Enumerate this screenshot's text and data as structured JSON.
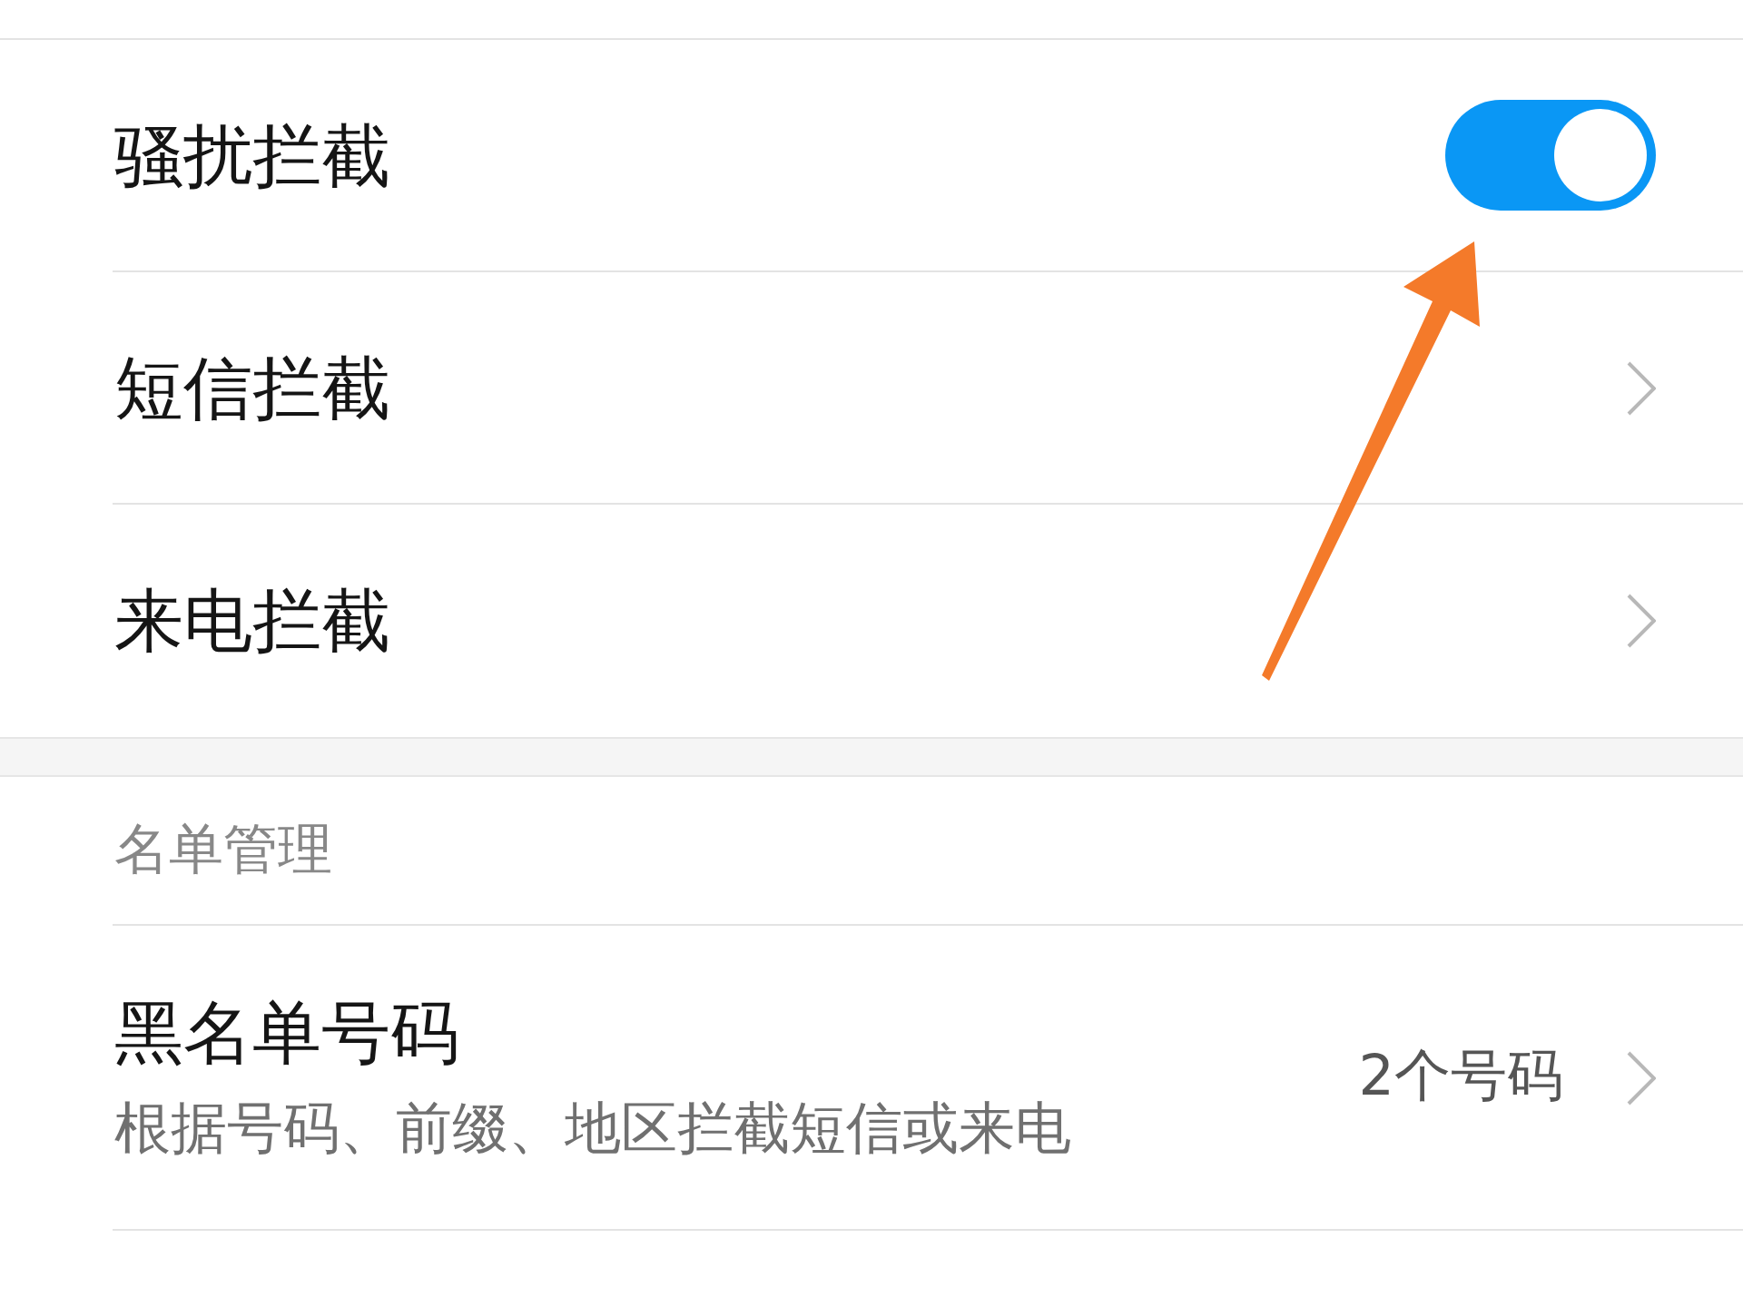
{
  "sections": [
    {
      "items": [
        {
          "kind": "toggle",
          "label": "骚扰拦截",
          "on": true
        },
        {
          "kind": "link",
          "label": "短信拦截"
        },
        {
          "kind": "link",
          "label": "来电拦截"
        }
      ]
    },
    {
      "header": "名单管理",
      "items": [
        {
          "kind": "link",
          "label": "黑名单号码",
          "description": "根据号码、前缀、地区拦截短信或来电",
          "value": "2个号码"
        }
      ]
    }
  ]
}
